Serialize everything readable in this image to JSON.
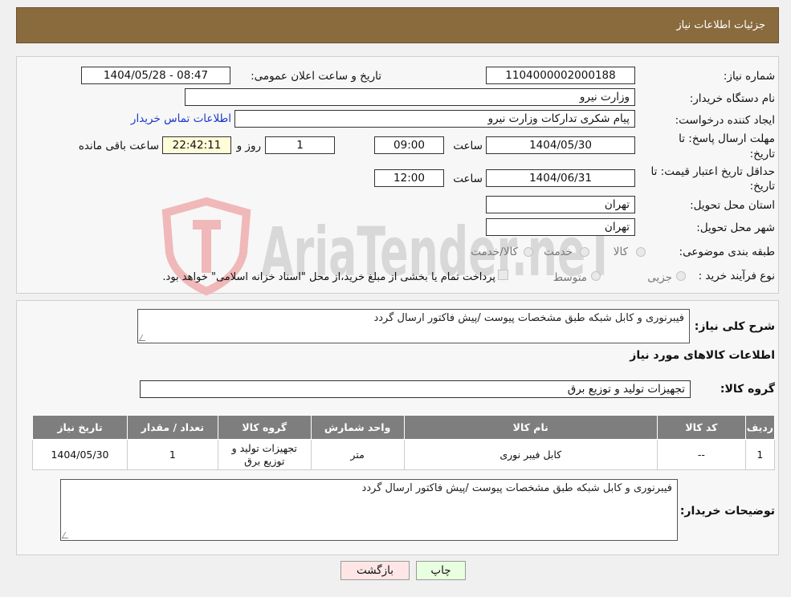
{
  "header": {
    "title": "جزئیات اطلاعات نیاز"
  },
  "form": {
    "need_number_label": "شماره نیاز:",
    "need_number": "1104000002000188",
    "announce_label": "تاریخ و ساعت اعلان عمومی:",
    "announce_value": "1404/05/28 - 08:47",
    "buyer_org_label": "نام دستگاه خریدار:",
    "buyer_org": "وزارت نیرو",
    "creator_label": "ایجاد کننده درخواست:",
    "creator": "پیام شکری تدارکات وزارت نیرو",
    "contact_link": "اطلاعات تماس خریدار",
    "deadline_label_1": "مهلت ارسال پاسخ: تا",
    "deadline_label_2": "تاریخ:",
    "deadline_date": "1404/05/30",
    "time_label": "ساعت",
    "deadline_time": "09:00",
    "days": "1",
    "days_label": "روز و",
    "remaining": "22:42:11",
    "remaining_label": "ساعت باقی مانده",
    "validity_label_1": "حداقل تاریخ اعتبار قیمت: تا",
    "validity_label_2": "تاریخ:",
    "validity_date": "1404/06/31",
    "validity_time": "12:00",
    "province_label": "استان محل تحویل:",
    "province": "تهران",
    "city_label": "شهر محل تحویل:",
    "city": "تهران",
    "category_label": "طبقه بندی موضوعی:",
    "category_options": [
      "کالا",
      "خدمت",
      "کالا/خدمت"
    ],
    "process_label": "نوع فرآیند خرید :",
    "process_options": [
      "جزیی",
      "متوسط"
    ],
    "process_note": "پرداخت تمام یا بخشی از مبلغ خرید،از محل \"اسناد خزانه اسلامی\" خواهد بود."
  },
  "description": {
    "label": "شرح کلی نیاز:",
    "text": "فیبرنوری و کابل شبکه طبق مشخصات پیوست /پیش فاکتور ارسال گردد"
  },
  "goods": {
    "section_title": "اطلاعات کالاهای مورد نیاز",
    "group_label": "گروه کالا:",
    "group_value": "تجهیزات تولید و توزیع برق",
    "columns": [
      "ردیف",
      "کد کالا",
      "نام کالا",
      "واحد شمارش",
      "گروه کالا",
      "تعداد / مقدار",
      "تاریخ نیاز"
    ],
    "rows": [
      {
        "row": "1",
        "code": "--",
        "name": "کابل فیبر نوری",
        "unit": "متر",
        "group": "تجهیزات تولید و توزیع برق",
        "qty": "1",
        "date": "1404/05/30"
      }
    ]
  },
  "buyer_notes": {
    "label": "توضیحات خریدار:",
    "text": "فیبرنوری و کابل شبکه طبق مشخصات پیوست /پیش فاکتور ارسال گردد"
  },
  "buttons": {
    "print": "چاپ",
    "back": "بازگشت"
  },
  "watermark": {
    "text": "AriaTender.neT"
  },
  "colors": {
    "header": "#8a6b3e",
    "link": "#1a37c9",
    "print_btn": "#e8ffe0",
    "back_btn": "#ffe6e6",
    "table_head": "#7e7e7e"
  }
}
